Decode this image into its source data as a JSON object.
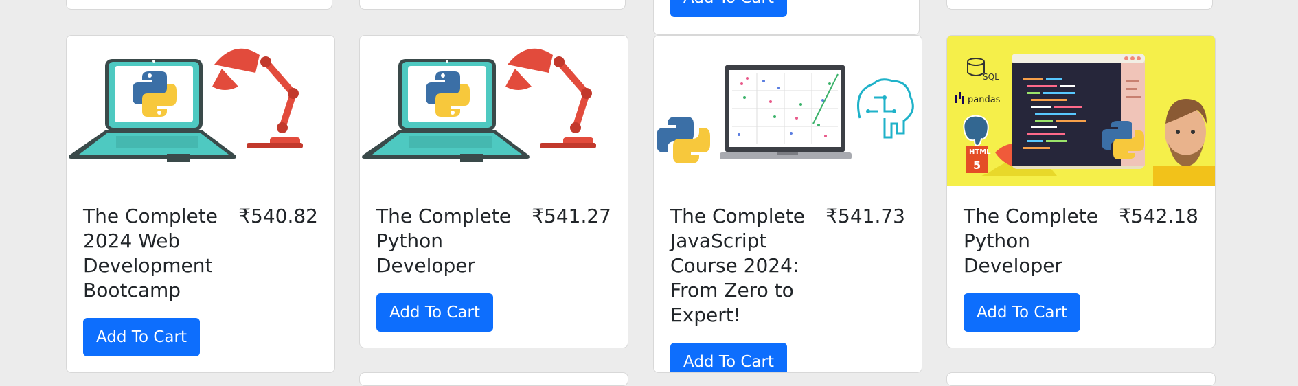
{
  "top_row": {
    "partial_button_label": "Add To Cart"
  },
  "products": [
    {
      "title": "The Complete 2024 Web Development Bootcamp",
      "price": "₹540.82",
      "button_label": "Add To Cart",
      "image": "python-laptop-lamp"
    },
    {
      "title": "The Complete Python Developer",
      "price": "₹541.27",
      "button_label": "Add To Cart",
      "image": "python-laptop-lamp"
    },
    {
      "title": "The Complete JavaScript Course 2024: From Zero to Expert!",
      "price": "₹541.73",
      "button_label": "Add To Cart",
      "image": "python-data-science-laptop-brain"
    },
    {
      "title": "The Complete Python Developer",
      "price": "₹542.18",
      "button_label": "Add To Cart",
      "image": "python-developer-yellow-banner",
      "image_labels": {
        "sql": "SQL",
        "pandas": "pandas",
        "html": "HTML",
        "html_number": "5"
      }
    }
  ],
  "colors": {
    "page_background": "#ececec",
    "button": "#0d6efd",
    "banner_yellow": "#f5ef4a"
  }
}
